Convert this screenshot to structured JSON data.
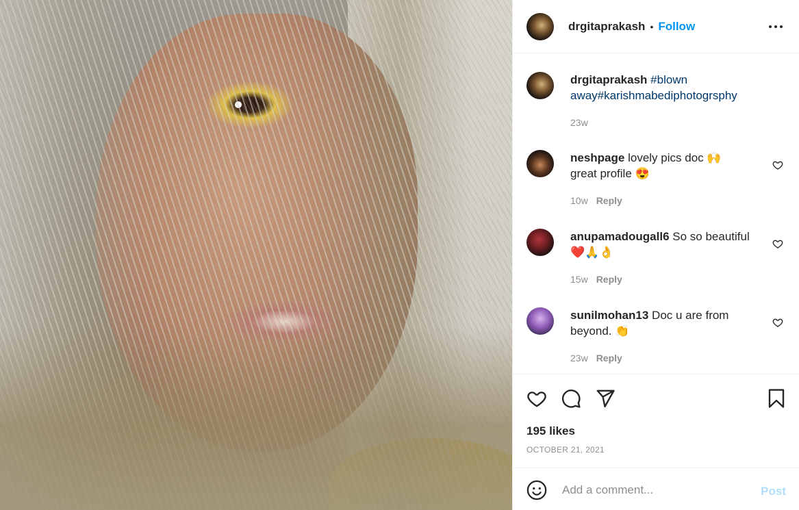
{
  "post": {
    "image_alt": "",
    "header": {
      "username": "drgitaprakash",
      "separator": "•",
      "follow_label": "Follow"
    },
    "caption": {
      "username": "drgitaprakash",
      "text_1": "#blown",
      "text_2": "away#karishmabediphotogrsphy",
      "time": "23w"
    },
    "comments": [
      {
        "username": "neshpage",
        "text": "lovely pics doc 🙌 great profile 😍",
        "time": "10w",
        "reply_label": "Reply"
      },
      {
        "username": "anupamadougall6",
        "text": "So so beautiful ❤️🙏👌",
        "time": "15w",
        "reply_label": "Reply"
      },
      {
        "username": "sunilmohan13",
        "text": "Doc u are from beyond. 👏",
        "time": "23w",
        "reply_label": "Reply"
      }
    ],
    "likes": "195 likes",
    "date": "OCTOBER 21, 2021",
    "add_comment": {
      "placeholder": "Add a comment...",
      "post_label": "Post"
    }
  },
  "icons": {
    "header_more": "more-options-icon",
    "like": "heart-icon",
    "comment": "comment-icon",
    "share": "paper-plane-icon",
    "save": "bookmark-icon",
    "emoji": "smiley-icon",
    "comment_like": "heart-outline-icon"
  },
  "colors": {
    "follow": "#0095f6",
    "hashtag": "#00376b",
    "muted": "#8e8e8e",
    "post_disabled": "#b2dffc"
  }
}
